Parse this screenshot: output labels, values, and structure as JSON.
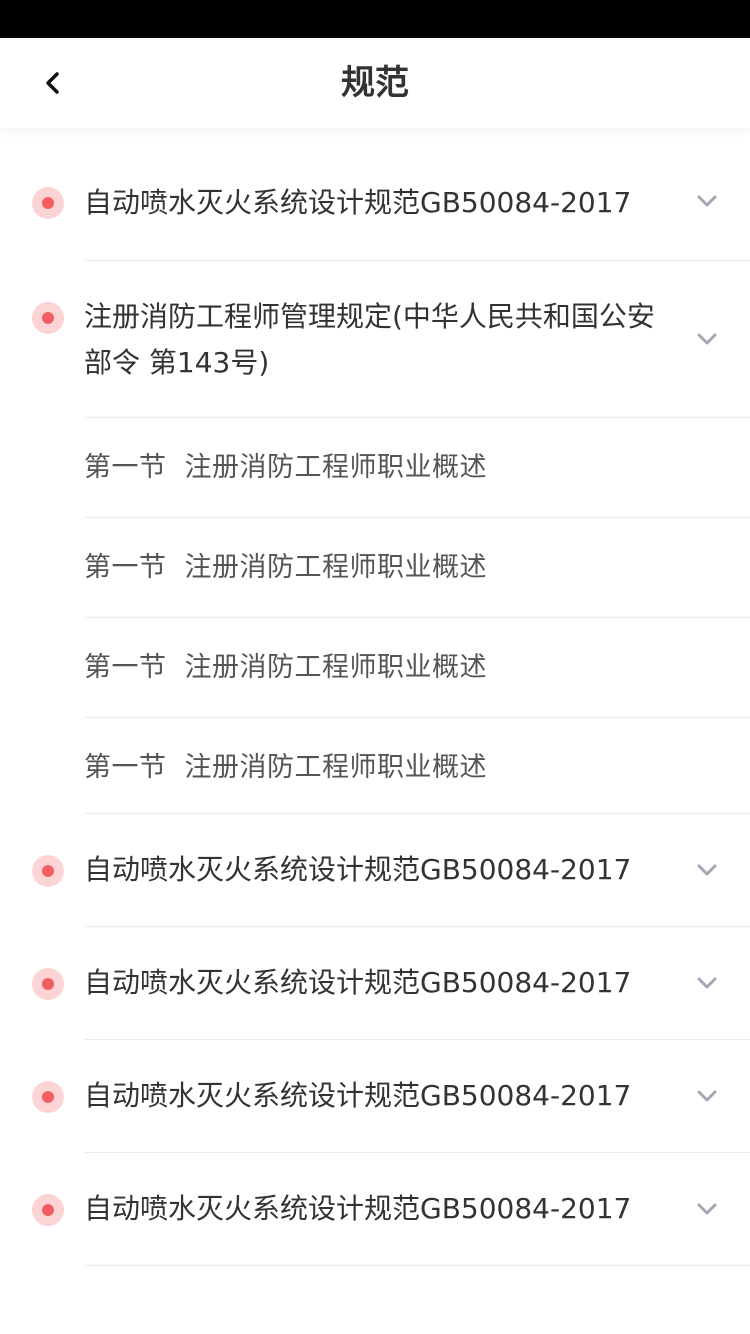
{
  "nav": {
    "title": "规范"
  },
  "colors": {
    "dot_outer": "#fdd4d5",
    "dot_inner": "#f25e63",
    "chevron": "#a3a7b3",
    "divider": "#ececec"
  },
  "icons": {
    "back": "chevron-left-icon",
    "expand": "chevron-down-icon",
    "bullet": "red-dot-icon"
  },
  "items": [
    {
      "title": "自动喷水灭火系统设计规范GB50084-2017"
    },
    {
      "title": "注册消防工程师管理规定(中华人民共和国公安部令 第143号)",
      "expanded": true,
      "sections": [
        {
          "chapter": "第一节",
          "name": "注册消防工程师职业概述"
        },
        {
          "chapter": "第一节",
          "name": "注册消防工程师职业概述"
        },
        {
          "chapter": "第一节",
          "name": "注册消防工程师职业概述"
        },
        {
          "chapter": "第一节",
          "name": "注册消防工程师职业概述"
        }
      ]
    },
    {
      "title": "自动喷水灭火系统设计规范GB50084-2017"
    },
    {
      "title": "自动喷水灭火系统设计规范GB50084-2017"
    },
    {
      "title": "自动喷水灭火系统设计规范GB50084-2017"
    },
    {
      "title": "自动喷水灭火系统设计规范GB50084-2017"
    }
  ]
}
